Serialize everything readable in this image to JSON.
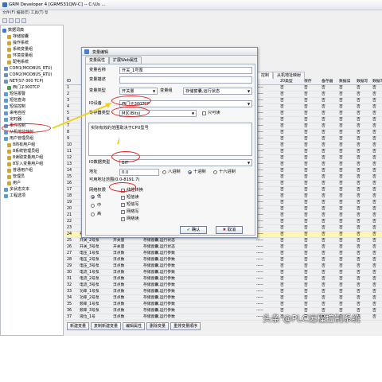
{
  "app": {
    "title": "GRM Developer 4 [GRM531QW-C] -- C:\\Us ...",
    "menu": "文件(F) 编辑(E) 工具(T) 帮助(H)"
  },
  "tree": [
    {
      "label": "数据词典",
      "indent": 2,
      "color": "#3a7ad8"
    },
    {
      "label": "存储窗囊",
      "indent": 8,
      "color": "#d8a030"
    },
    {
      "label": "操作系统",
      "indent": 8,
      "color": "#d8a030"
    },
    {
      "label": "系统变量组",
      "indent": 8,
      "color": "#d8a030"
    },
    {
      "label": "环境变量组",
      "indent": 8,
      "color": "#d8a030"
    },
    {
      "label": "配电系统",
      "indent": 8,
      "color": "#d8a030"
    },
    {
      "label": "COM1(MODBUS_RTU)",
      "indent": 4,
      "color": "#6a8fc0"
    },
    {
      "label": "COM2(MODBUS_RTU)",
      "indent": 4,
      "color": "#6a8fc0"
    },
    {
      "label": "NET(S7-300 TCP)",
      "indent": 4,
      "color": "#6a8fc0"
    },
    {
      "label": "西门子300TCP",
      "indent": 8,
      "color": "#4aa04a"
    },
    {
      "label": "短信报警",
      "indent": 4,
      "color": "#5a9ad8"
    },
    {
      "label": "短信查询",
      "indent": 4,
      "color": "#5a9ad8"
    },
    {
      "label": "短信控制",
      "indent": 4,
      "color": "#5a9ad8"
    },
    {
      "label": "来电自控",
      "indent": 4,
      "color": "#5a9ad8"
    },
    {
      "label": "定时器",
      "indent": 4,
      "color": "#5a9ad8"
    },
    {
      "label": "事件控制",
      "indent": 4,
      "color": "#5a9ad8"
    },
    {
      "label": "从机地址映射",
      "indent": 4,
      "color": "#5a9ad8"
    },
    {
      "label": "用户管理员组",
      "indent": 4,
      "color": "#5a9ad8"
    },
    {
      "label": "8商有用户组",
      "indent": 8,
      "color": "#d8a030"
    },
    {
      "label": "8系统管理员组",
      "indent": 8,
      "color": "#d8a030"
    },
    {
      "label": "8读取变量用户组",
      "indent": 8,
      "color": "#d8a030"
    },
    {
      "label": "8写入变量用户组",
      "indent": 8,
      "color": "#d8a030"
    },
    {
      "label": "普通用户组",
      "indent": 8,
      "color": "#d8a030"
    },
    {
      "label": "管理员",
      "indent": 8,
      "color": "#d8a030"
    },
    {
      "label": "用户",
      "indent": 8,
      "color": "#d8a030"
    },
    {
      "label": "多状态文本",
      "indent": 4,
      "color": "#5a9ad8"
    },
    {
      "label": "工程选项",
      "indent": 4,
      "color": "#5a9ad8"
    }
  ],
  "tabs": [
    "控制",
    "从机地址映射"
  ],
  "grid": {
    "headers": [
      "ID",
      "",
      "",
      "",
      "",
      "20类型",
      "保存",
      "备存器",
      "数据读",
      "数据写",
      "数据写"
    ],
    "rows": [
      {
        "id": "1"
      },
      {
        "id": "2"
      },
      {
        "id": "3"
      },
      {
        "id": "4"
      },
      {
        "id": "5"
      },
      {
        "id": "6"
      },
      {
        "id": "7"
      },
      {
        "id": "8"
      },
      {
        "id": "9"
      },
      {
        "id": "10"
      },
      {
        "id": "11"
      },
      {
        "id": "12"
      },
      {
        "id": "13"
      },
      {
        "id": "14"
      },
      {
        "id": "15"
      },
      {
        "id": "16"
      },
      {
        "id": "17"
      },
      {
        "id": "18"
      },
      {
        "id": "19"
      },
      {
        "id": "20"
      },
      {
        "id": "21"
      },
      {
        "id": "22"
      },
      {
        "id": "23"
      },
      {
        "id": "24",
        "name": "开关_1号泵",
        "type": "开关量",
        "group": "存储窗囊,运行状态",
        "sel": true
      },
      {
        "id": "25",
        "name": "开关_2号泵",
        "type": "开关量",
        "group": "存储窗囊,运行状态"
      },
      {
        "id": "26",
        "name": "开关_3号泵",
        "type": "开关量",
        "group": "存储窗囊,运行状态"
      },
      {
        "id": "27",
        "name": "电压_1号泵",
        "type": "浮点数",
        "group": "存储窗囊,运行参数"
      },
      {
        "id": "28",
        "name": "电压_2号泵",
        "type": "浮点数",
        "group": "存储窗囊,运行参数"
      },
      {
        "id": "29",
        "name": "电压_3号泵",
        "type": "浮点数",
        "group": "存储窗囊,运行参数"
      },
      {
        "id": "30",
        "name": "电流_1号泵",
        "type": "浮点数",
        "group": "存储窗囊,运行参数"
      },
      {
        "id": "31",
        "name": "电流_2号泵",
        "type": "浮点数",
        "group": "存储窗囊,运行参数"
      },
      {
        "id": "32",
        "name": "电流_3号泵",
        "type": "浮点数",
        "group": "存储窗囊,运行参数"
      },
      {
        "id": "33",
        "name": "功率_1号泵",
        "type": "浮点数",
        "group": "存储窗囊,运行参数"
      },
      {
        "id": "34",
        "name": "功率_2号泵",
        "type": "浮点数",
        "group": "存储窗囊,运行参数"
      },
      {
        "id": "35",
        "name": "频率_1号泵",
        "type": "浮点数",
        "group": "存储窗囊,运行参数"
      },
      {
        "id": "36",
        "name": "频率_3号泵",
        "type": "浮点数",
        "group": "存储窗囊,运行参数"
      },
      {
        "id": "37",
        "name": "液位_1号",
        "type": "浮点数",
        "group": "存储窗囊,运行参数"
      }
    ],
    "filler": "-----",
    "no": "否"
  },
  "bottom_buttons": [
    "新建变量",
    "复制新建变量",
    "编辑属性",
    "删除变量",
    "重排变量顺序"
  ],
  "dialog": {
    "title": "变量编辑",
    "tabs": [
      "变量属性",
      "扩展Web属性"
    ],
    "var_name_label": "变量名称",
    "var_name": "开关_1号泵",
    "var_desc_label": "变量描述",
    "var_desc": "",
    "var_type_label": "变量类型",
    "var_type": "开关量",
    "var_group_label": "变量组",
    "var_group": "存储窗囊,运行状态",
    "io_dev_label": "IO设备",
    "io_dev": "西门子300TCP",
    "reg_type_label": "寄存器类型",
    "reg_type": "M区(Bits)",
    "readonly_label": "只可读",
    "hint": "实际有效的范围取决于CPU型号",
    "io_data_type_label": "IO数据类型",
    "io_data_type": "BIT",
    "addr_label": "地址",
    "addr": "0.0",
    "radix": [
      "八进制",
      "十进制",
      "十六进制"
    ],
    "addr_range": "可用地址范围(0.0-8191.7)",
    "net_perm_label": "网络权限",
    "perm": [
      "低",
      "中",
      "高"
    ],
    "checks": [
      "线性转换",
      "短信读",
      "短信写",
      "网络写",
      "网络读"
    ],
    "ok": "确认",
    "cancel": "取消"
  },
  "watermark": "头条 @PLC远程控制系统",
  "colors": {
    "highlight": "#e02020",
    "selection": "#fff6b0",
    "accent": "#3a6fc4"
  }
}
